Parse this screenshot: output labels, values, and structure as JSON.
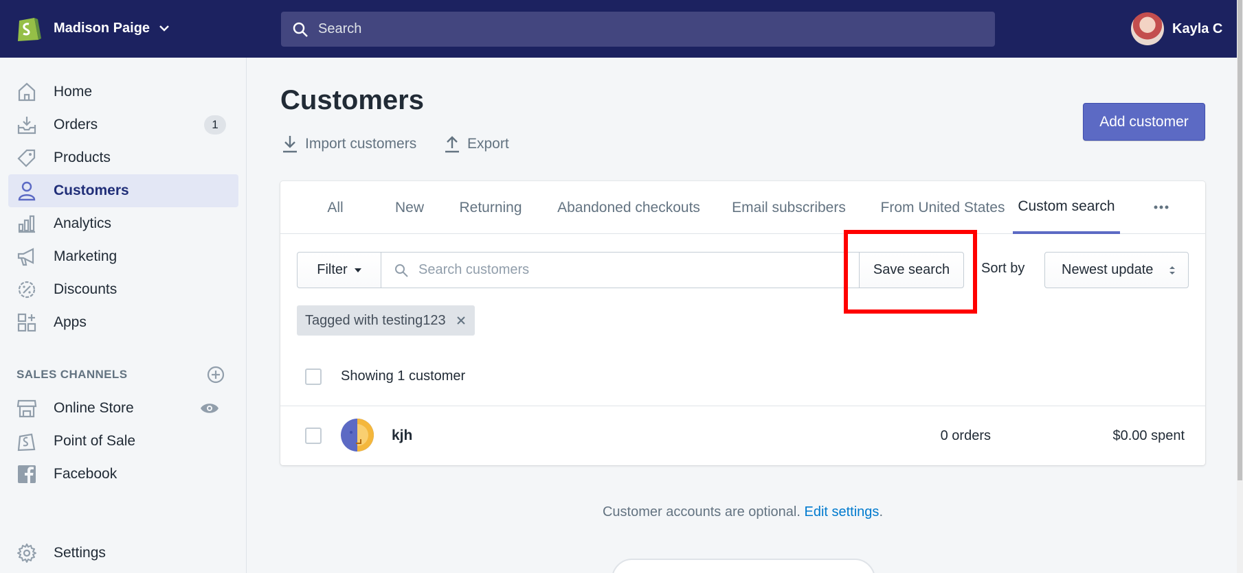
{
  "topbar": {
    "store_name": "Madison Paige",
    "search_placeholder": "Search",
    "user_name": "Kayla C"
  },
  "sidebar": {
    "items": [
      {
        "label": "Home",
        "icon": "home-icon"
      },
      {
        "label": "Orders",
        "icon": "orders-icon",
        "badge": "1"
      },
      {
        "label": "Products",
        "icon": "tag-icon"
      },
      {
        "label": "Customers",
        "icon": "person-icon",
        "active": true
      },
      {
        "label": "Analytics",
        "icon": "bar-chart-icon"
      },
      {
        "label": "Marketing",
        "icon": "megaphone-icon"
      },
      {
        "label": "Discounts",
        "icon": "discount-icon"
      },
      {
        "label": "Apps",
        "icon": "apps-icon"
      }
    ],
    "sales_channels_heading": "SALES CHANNELS",
    "channels": [
      {
        "label": "Online Store",
        "icon": "store-icon"
      },
      {
        "label": "Point of Sale",
        "icon": "shopping-bag-icon"
      },
      {
        "label": "Facebook",
        "icon": "facebook-icon"
      }
    ],
    "settings_label": "Settings"
  },
  "page": {
    "title": "Customers",
    "import_label": "Import customers",
    "export_label": "Export",
    "add_customer_label": "Add customer"
  },
  "tabs": [
    "All",
    "New",
    "Returning",
    "Abandoned checkouts",
    "Email subscribers",
    "From United States",
    "Custom search"
  ],
  "active_tab": "Custom search",
  "filters": {
    "filter_label": "Filter",
    "search_placeholder": "Search customers",
    "search_value": "",
    "save_search_label": "Save search",
    "sort_by_label": "Sort by",
    "sort_value": "Newest update",
    "applied_tag": "Tagged with testing123"
  },
  "results": {
    "showing_text": "Showing 1 customer",
    "customers": [
      {
        "name": "kjh",
        "orders": "0 orders",
        "spent": "$0.00 spent"
      }
    ]
  },
  "footer": {
    "note": "Customer accounts are optional.",
    "link": "Edit settings",
    "after": "."
  },
  "colors": {
    "topbar": "#1c2260",
    "primary": "#5c6ac4",
    "highlight": "#ff0000",
    "link": "#007ace"
  }
}
